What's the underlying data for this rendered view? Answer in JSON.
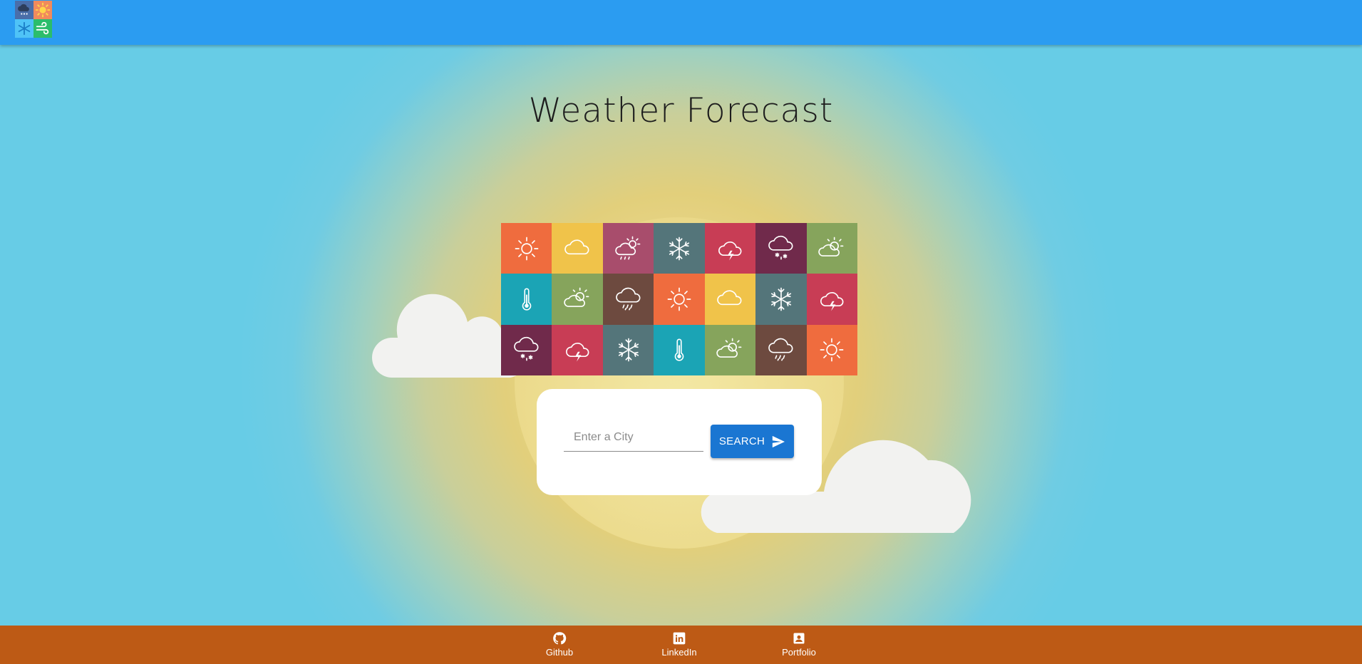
{
  "app": {
    "logo_icons": [
      "snow-cloud-icon",
      "sun-icon",
      "snowflake-icon",
      "wind-icon"
    ],
    "logo_colors": [
      "#4a6ea9",
      "#f08a5d",
      "#4fc3f7",
      "#2bbd6b"
    ]
  },
  "main": {
    "title": "Weather Forecast"
  },
  "tiles": [
    {
      "icon": "sun-icon",
      "color": "#ef6c3e"
    },
    {
      "icon": "cloud-icon",
      "color": "#f0c34a"
    },
    {
      "icon": "sun-cloud-rain-icon",
      "color": "#a84d6c"
    },
    {
      "icon": "snowflake-icon",
      "color": "#54757a"
    },
    {
      "icon": "thunderstorm-icon",
      "color": "#c83d55"
    },
    {
      "icon": "snow-cloud-icon",
      "color": "#702a4b"
    },
    {
      "icon": "partly-cloudy-icon",
      "color": "#86a45c"
    },
    {
      "icon": "thermometer-icon",
      "color": "#1ba4b5"
    },
    {
      "icon": "partly-cloudy-icon",
      "color": "#86a45c"
    },
    {
      "icon": "rain-cloud-icon",
      "color": "#6d4a3f"
    },
    {
      "icon": "sun-icon",
      "color": "#ef6c3e"
    },
    {
      "icon": "cloud-icon",
      "color": "#f0c34a"
    },
    {
      "icon": "snowflake-icon",
      "color": "#54757a"
    },
    {
      "icon": "thunderstorm-icon",
      "color": "#c83d55"
    },
    {
      "icon": "snow-cloud-icon",
      "color": "#702a4b"
    },
    {
      "icon": "thunderstorm-icon",
      "color": "#c83d55"
    },
    {
      "icon": "snowflake-icon",
      "color": "#54757a"
    },
    {
      "icon": "thermometer-icon",
      "color": "#1ba4b5"
    },
    {
      "icon": "partly-cloudy-icon",
      "color": "#86a45c"
    },
    {
      "icon": "rain-cloud-icon",
      "color": "#6d4a3f"
    },
    {
      "icon": "sun-icon",
      "color": "#ef6c3e"
    }
  ],
  "search": {
    "placeholder": "Enter a City",
    "value": "",
    "button_label": "SEARCH",
    "button_icon": "send-icon",
    "button_color": "#1a76d2"
  },
  "footer": {
    "links": [
      {
        "label": "Github",
        "icon": "github-icon"
      },
      {
        "label": "LinkedIn",
        "icon": "linkedin-icon"
      },
      {
        "label": "Portfolio",
        "icon": "portfolio-icon"
      }
    ],
    "color": "#bd5a15"
  },
  "colors": {
    "appbar": "#2b9cf1",
    "sky": "#67cce6",
    "sun": "#f3e7a3"
  }
}
